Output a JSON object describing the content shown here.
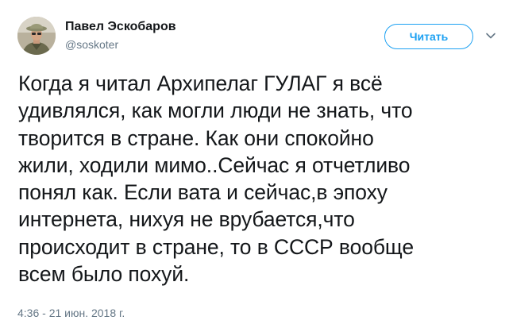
{
  "user": {
    "display_name": "Павел Эскобаров",
    "handle": "@soskoter"
  },
  "follow_button": {
    "label": "Читать"
  },
  "tweet": {
    "text": "Когда я читал Архипелаг ГУЛАГ я всё\nудивлялся, как могли люди не знать, что\nтворится в стране. Как они спокойно\nжили, ходили мимо..Сейчас я отчетливо\nпонял как. Если вата и сейчас,в эпоху\nинтернета, нихуя не врубается,что\nпроисходит в стране, то в СССР вообще\nвсем было похуй.",
    "timestamp": "4:36 - 21 июн. 2018 г."
  },
  "icons": {
    "menu": "chevron-down-icon"
  },
  "colors": {
    "accent": "#1da1f2",
    "text": "#14171a",
    "secondary_text": "#657786"
  }
}
